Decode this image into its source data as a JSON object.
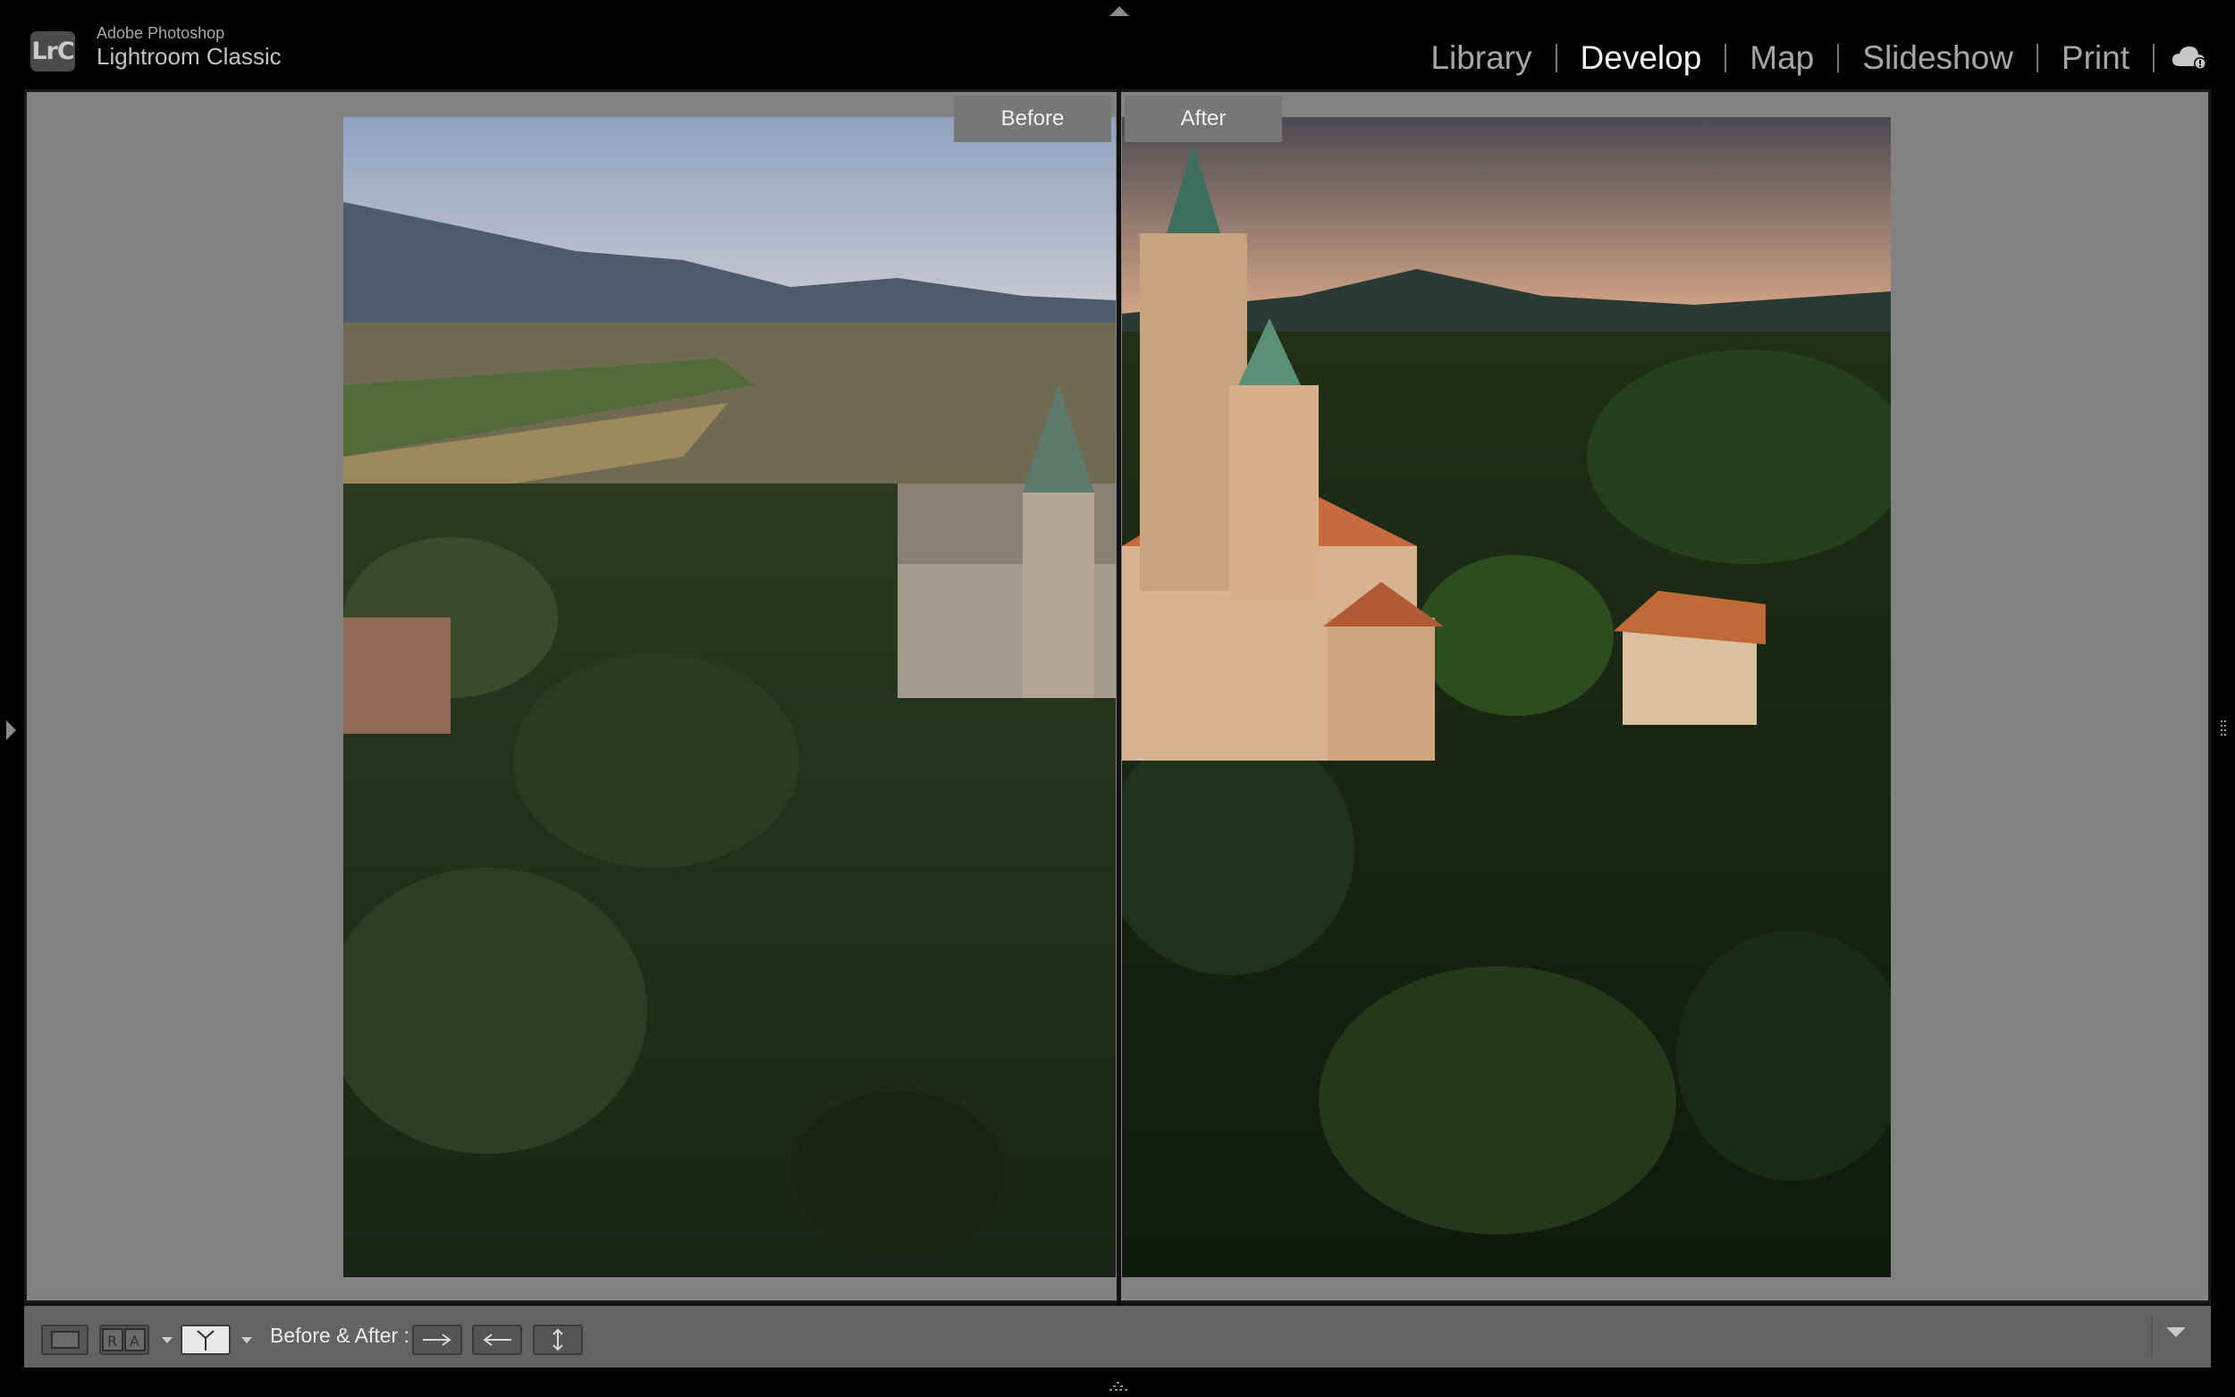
{
  "app": {
    "badge": "LrC",
    "vendor": "Adobe Photoshop",
    "name": "Lightroom Classic"
  },
  "modules": [
    {
      "label": "Library",
      "active": false
    },
    {
      "label": "Develop",
      "active": true
    },
    {
      "label": "Map",
      "active": false
    },
    {
      "label": "Slideshow",
      "active": false
    },
    {
      "label": "Print",
      "active": false
    }
  ],
  "view": {
    "before_label": "Before",
    "after_label": "After"
  },
  "toolbar": {
    "before_after_label": "Before & After :"
  },
  "colors": {
    "background": "#828282",
    "toolbar": "#636363",
    "active_module": "#f2f2f2",
    "inactive_module": "#a6a6a6"
  },
  "icons": [
    "lightroom-logo-icon",
    "cloud-sync-icon",
    "loupe-view-icon",
    "reference-view-icon",
    "before-after-split-icon",
    "copy-before-to-after-icon",
    "copy-after-to-before-icon",
    "swap-before-after-icon"
  ]
}
